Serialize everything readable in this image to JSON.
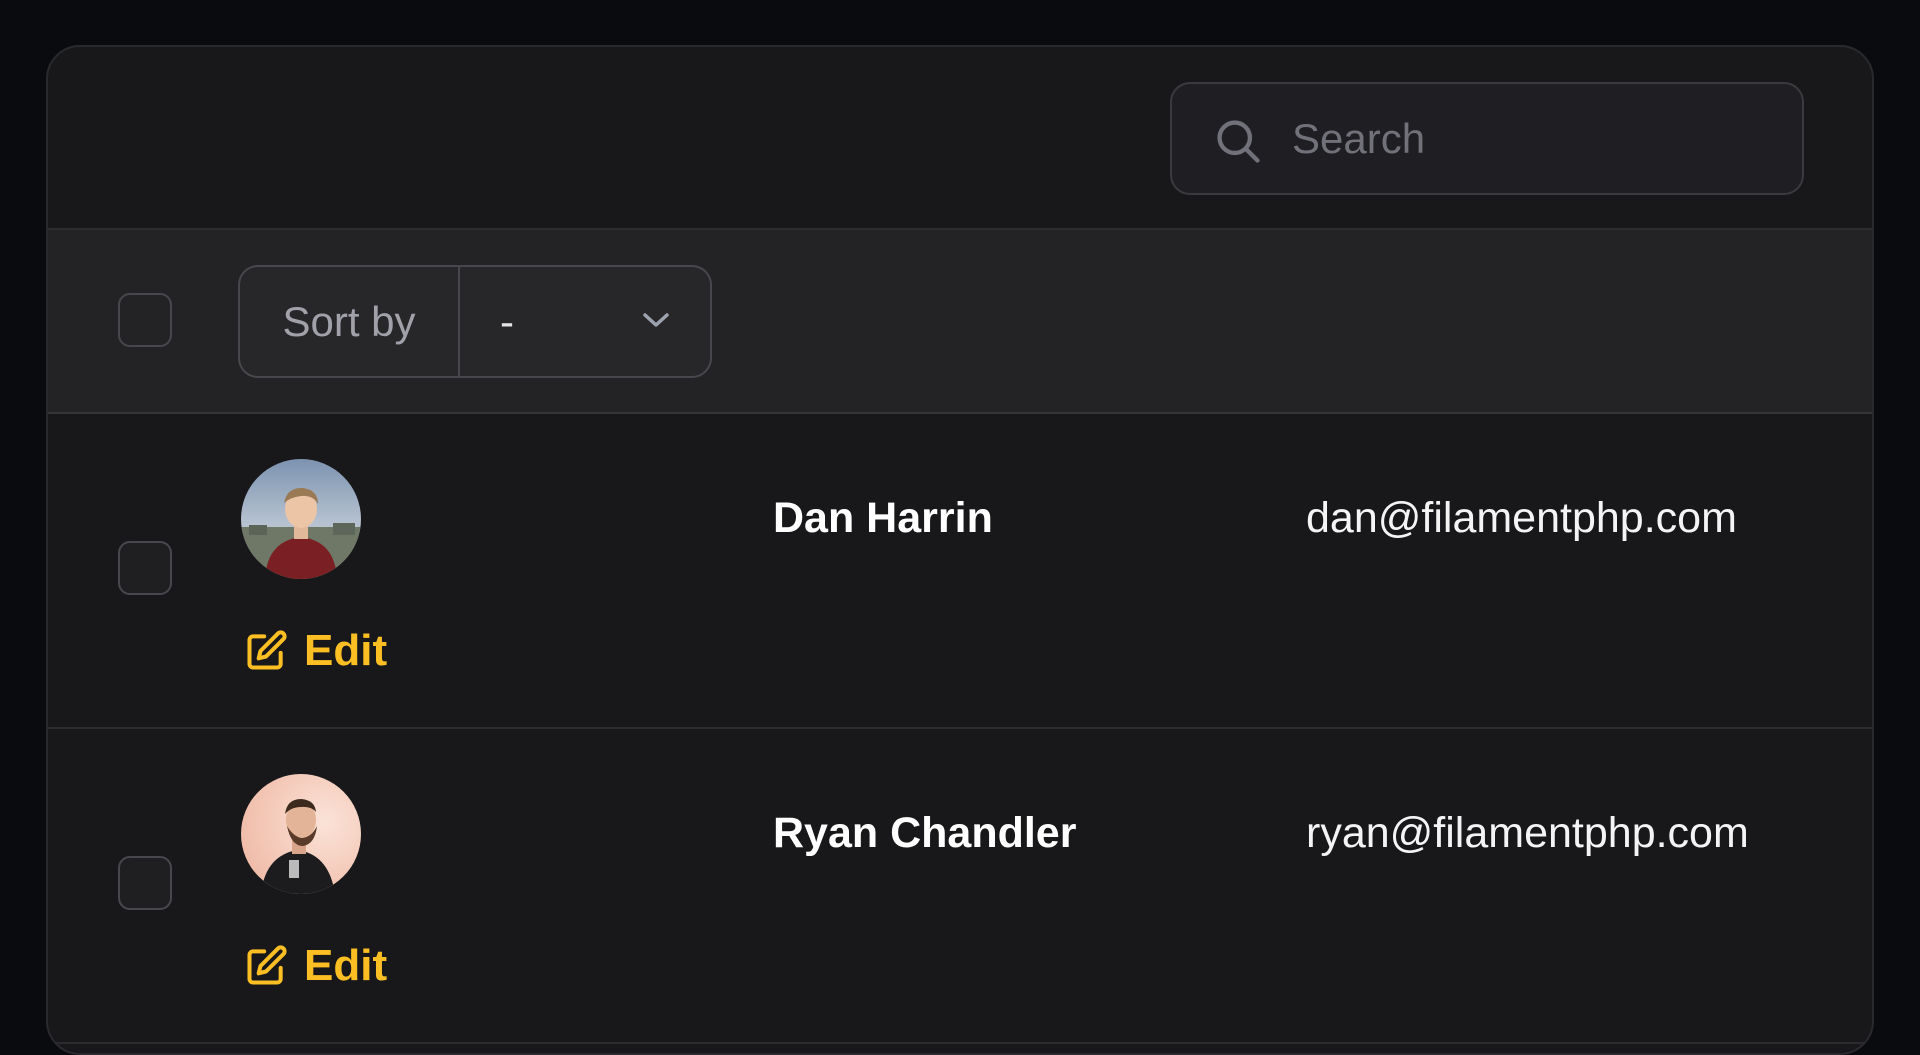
{
  "search": {
    "placeholder": "Search",
    "icon": "search-icon"
  },
  "toolbar": {
    "sort_label": "Sort by",
    "sort_value": "-",
    "select_all_checked": false
  },
  "rows": [
    {
      "name": "Dan Harrin",
      "email": "dan@filamentphp.com",
      "edit_label": "Edit",
      "checked": false
    },
    {
      "name": "Ryan Chandler",
      "email": "ryan@filamentphp.com",
      "edit_label": "Edit",
      "checked": false
    }
  ],
  "colors": {
    "accent": "#fbbf24",
    "background": "#0a0b0e",
    "card": "#18181b",
    "toolbar": "#232326"
  }
}
